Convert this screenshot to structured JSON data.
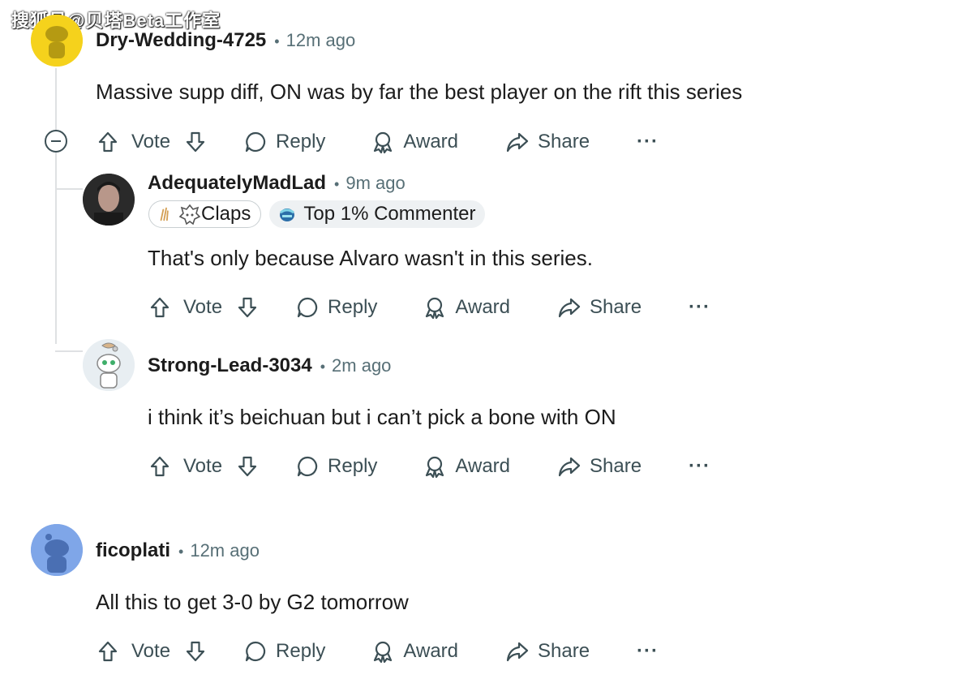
{
  "watermark": "搜狐号@贝塔Beta工作室",
  "comments": [
    {
      "username": "Dry-Wedding-4725",
      "separator": "•",
      "time": "12m ago",
      "body": "Massive supp diff, ON was by far the best player on the rift this series",
      "avatar_color": "#f5d21c"
    },
    {
      "username": "AdequatelyMadLad",
      "separator": "•",
      "time": "9m ago",
      "flairs": [
        {
          "label": "Claps",
          "icon": "wolf-emblem-icon"
        },
        {
          "label": "Top 1% Commenter",
          "icon": "commenter-badge-icon"
        }
      ],
      "body": "That's only because Alvaro wasn't in this series.",
      "avatar_color": "#3a3a3a"
    },
    {
      "username": "Strong-Lead-3034",
      "separator": "•",
      "time": "2m ago",
      "body": "i think it’s beichuan but i can’t pick a bone with ON",
      "avatar_color": "#e8eef2"
    },
    {
      "username": "ficoplati",
      "separator": "•",
      "time": "12m ago",
      "body": "All this to get 3-0 by G2 tomorrow",
      "avatar_color": "#7fa6e8"
    }
  ],
  "actions": {
    "vote": "Vote",
    "reply": "Reply",
    "award": "Award",
    "share": "Share",
    "more": "···"
  },
  "colors": {
    "meta": "#576f76",
    "action": "#3c4f55",
    "thread_line": "#dfe1e3"
  }
}
